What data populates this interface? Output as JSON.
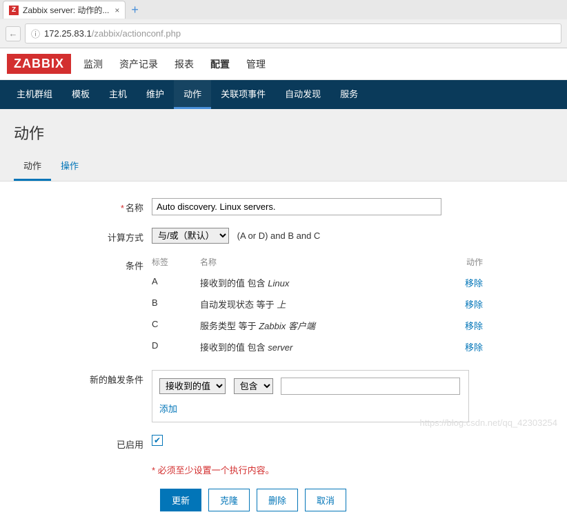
{
  "browser": {
    "tab_favicon": "Z",
    "tab_title": "Zabbix server: 动作的...",
    "tab_close": "×",
    "new_tab": "+",
    "back": "←",
    "info": "ⓘ",
    "url_host": "172.25.83.1",
    "url_path": "/zabbix/actionconf.php"
  },
  "header": {
    "logo": "ZABBIX",
    "nav": [
      "监测",
      "资产记录",
      "报表",
      "配置",
      "管理"
    ],
    "nav_active": 3
  },
  "subnav": {
    "items": [
      "主机群组",
      "模板",
      "主机",
      "维护",
      "动作",
      "关联项事件",
      "自动发现",
      "服务"
    ],
    "active": 4
  },
  "page": {
    "title": "动作"
  },
  "tabs": {
    "items": [
      "动作",
      "操作"
    ],
    "active": 0
  },
  "form": {
    "name_label": "名称",
    "name_value": "Auto discovery. Linux servers.",
    "calc_label": "计算方式",
    "calc_option": "与/或（默认）",
    "calc_hint": "(A or D) and B and C",
    "cond_label": "条件",
    "cond_head": {
      "tag": "标签",
      "name": "名称",
      "action": "动作"
    },
    "conditions": [
      {
        "tag": "A",
        "text_pre": "接收到的值 包含 ",
        "em": "Linux"
      },
      {
        "tag": "B",
        "text_pre": "自动发现状态 等于 ",
        "em": "上"
      },
      {
        "tag": "C",
        "text_pre": "服务类型 等于 ",
        "em": "Zabbix 客户端"
      },
      {
        "tag": "D",
        "text_pre": "接收到的值 包含 ",
        "em": "server"
      }
    ],
    "remove_label": "移除",
    "new_cond_label": "新的触发条件",
    "new_cond_type": "接收到的值",
    "new_cond_op": "包含",
    "new_cond_value": "",
    "add_label": "添加",
    "enabled_label": "已启用",
    "enabled_check": "✔",
    "warn": "必须至少设置一个执行内容。",
    "buttons": {
      "update": "更新",
      "clone": "克隆",
      "delete": "删除",
      "cancel": "取消"
    }
  },
  "watermark": "https://blog.csdn.net/qq_42303254"
}
